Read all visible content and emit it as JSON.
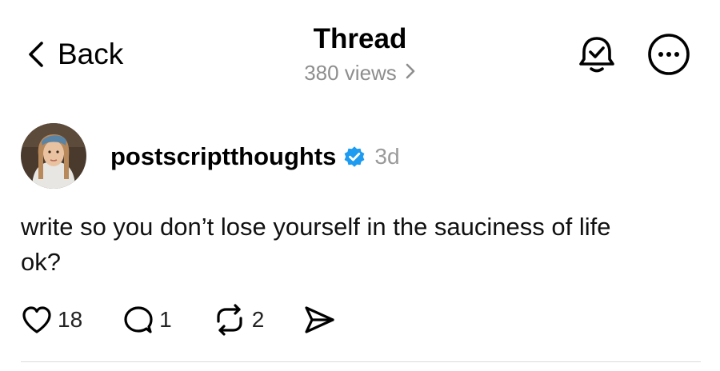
{
  "header": {
    "back_label": "Back",
    "title": "Thread",
    "views": "380 views"
  },
  "post": {
    "username": "postscriptthoughts",
    "time": "3d",
    "text_lines": [
      "write so you don’t lose yourself in the sauciness of life",
      "ok?"
    ],
    "likes": "18",
    "replies": "1",
    "reposts": "2"
  },
  "colors": {
    "text": "#000000",
    "secondary": "#8e8e8e",
    "verified": "#1d9bf0",
    "divider": "#dbdbdb"
  },
  "icons": {
    "back": "chevron-left-icon",
    "views": "chevron-right-icon",
    "notify": "bell-check-icon",
    "more": "more-icon",
    "verified": "verified-badge-icon",
    "like": "heart-icon",
    "reply": "comment-icon",
    "repost": "repost-icon",
    "share": "send-icon"
  }
}
